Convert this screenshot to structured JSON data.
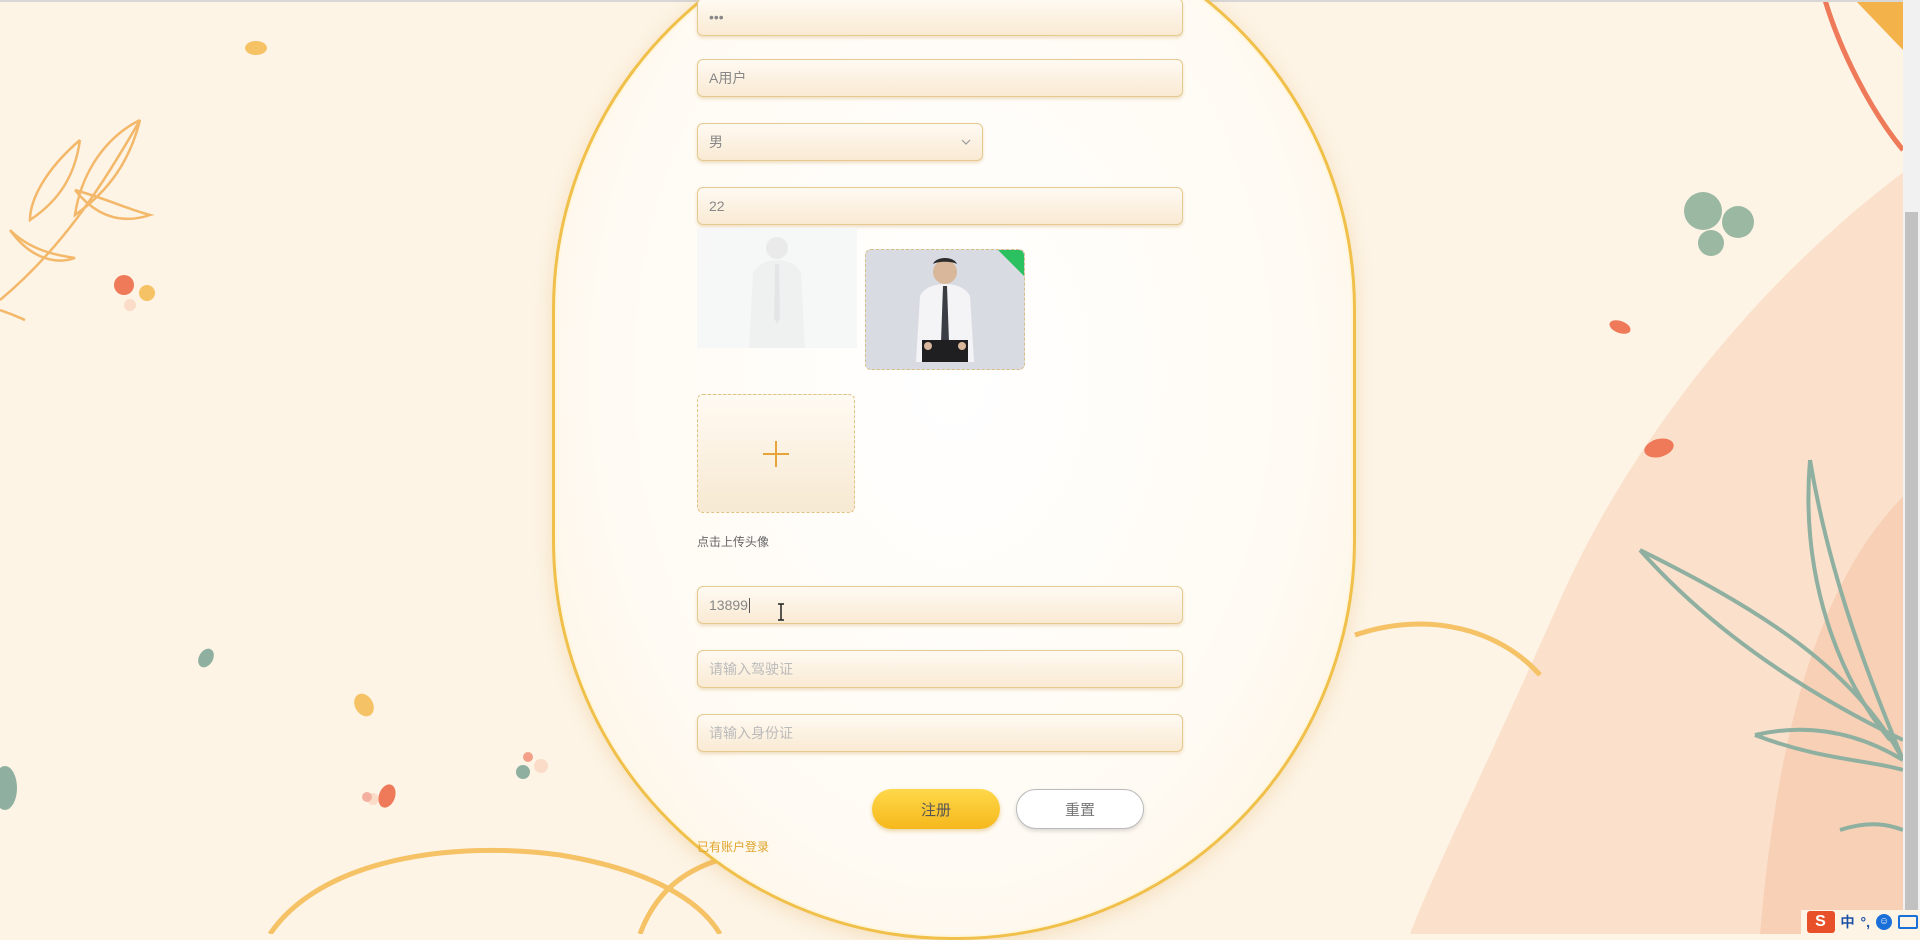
{
  "form": {
    "password_dots": "•••",
    "name_value": "A用户",
    "gender_value": "男",
    "age_value": "22",
    "upload_tip": "点击上传头像",
    "upload_icon": "plus-icon",
    "phone_value": "13899",
    "license_placeholder": "请输入驾驶证",
    "idcard_placeholder": "请输入身份证",
    "register_label": "注册",
    "reset_label": "重置",
    "login_link": "已有账户登录"
  },
  "ime": {
    "logo": "S",
    "lang": "中",
    "punct": "°,",
    "emoji_icon": "smiley-icon",
    "keyboard_icon": "keyboard-icon"
  },
  "colors": {
    "accent": "#f5b81c",
    "border": "#e5c98e",
    "background": "#fdf4e6",
    "badge": "#2cc160"
  }
}
